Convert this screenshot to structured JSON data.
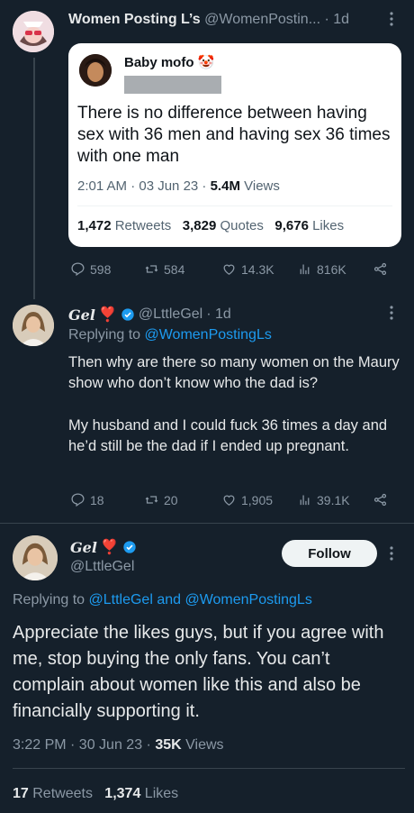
{
  "tweet1": {
    "name": "Women Posting L’s",
    "handle": "@WomenPostin...",
    "time": "· 1d",
    "stats": {
      "replies": "598",
      "retweets": "584",
      "likes": "14.3K",
      "views": "816K"
    }
  },
  "quote": {
    "name": "Baby mofo",
    "emoji": "🤡",
    "text": "There is no difference between having sex with 36 men and having sex 36 times with one man",
    "timestamp": "2:01 AM · 03 Jun 23 ·",
    "views_count": "5.4M",
    "views_label": "Views",
    "retweets_count": "1,472",
    "retweets_label": "Retweets",
    "quotes_count": "3,829",
    "quotes_label": "Quotes",
    "likes_count": "9,676",
    "likes_label": "Likes"
  },
  "tweet2": {
    "name": "Gel",
    "name_emoji": "❣️",
    "handle": "@LttleGel",
    "time": "· 1d",
    "replying_prefix": "Replying to",
    "replying_to": "@WomenPostingLs",
    "text_p1": "Then why are there so many women on the Maury show who don’t know who the dad is?",
    "text_p2": "My husband and I could fuck 36 times a day and he’d still be the dad if I ended up pregnant.",
    "stats": {
      "replies": "18",
      "retweets": "20",
      "likes": "1,905",
      "views": "39.1K"
    }
  },
  "tweet3": {
    "name": "Gel",
    "name_emoji": "❣️",
    "handle": "@LttleGel",
    "follow_label": "Follow",
    "replying_prefix": "Replying to",
    "replying_to": "@LttleGel and @WomenPostingLs",
    "text": "Appreciate the likes guys, but if you agree with me, stop buying the only fans. You can’t complain about women like this and also be financially supporting it.",
    "timestamp": "3:22 PM · 30 Jun 23 ·",
    "views_count": "35K",
    "views_label": "Views",
    "retweets_count": "17",
    "retweets_label": "Retweets",
    "likes_count": "1,374",
    "likes_label": "Likes"
  },
  "colors": {
    "background": "#15202b",
    "accent": "#1d9bf0",
    "muted": "#8b98a5",
    "verified": "#1d9bf0"
  }
}
